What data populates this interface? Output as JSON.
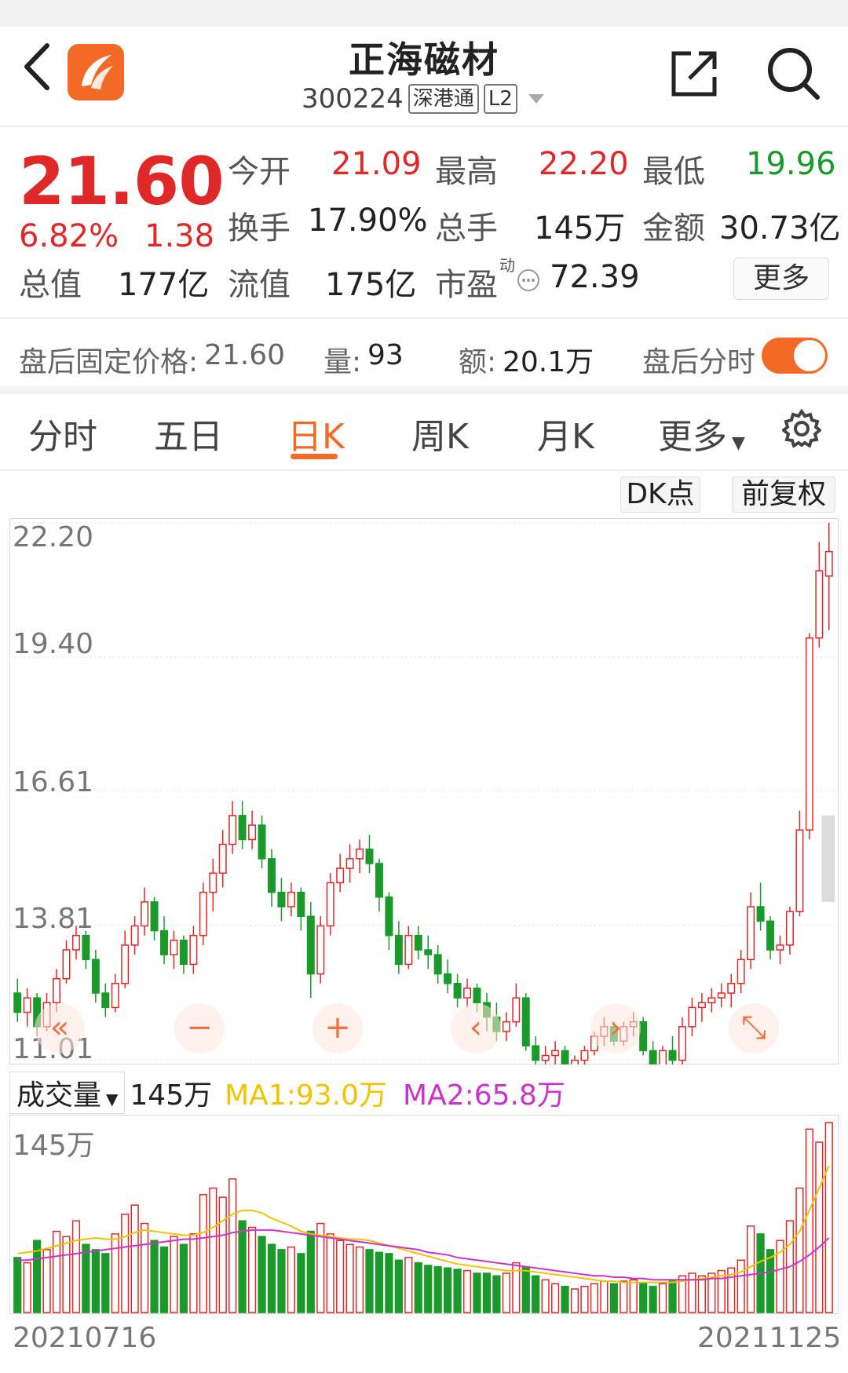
{
  "header": {
    "title": "正海磁材",
    "code": "300224",
    "tag1": "深港通",
    "tag2": "L2"
  },
  "quote": {
    "price": "21.60",
    "change_pct": "6.82%",
    "change": "1.38",
    "open_label": "今开",
    "open": "21.09",
    "high_label": "最高",
    "high": "22.20",
    "low_label": "最低",
    "low": "19.96",
    "turnover_label": "换手",
    "turnover": "17.90%",
    "volume_label": "总手",
    "volume": "145万",
    "amount_label": "金额",
    "amount": "30.73亿",
    "mcap_label": "总值",
    "mcap": "177亿",
    "float_label": "流值",
    "float": "175亿",
    "pe_label": "市盈",
    "pe_sup": "动",
    "pe": "72.39",
    "more": "更多"
  },
  "afterhours": {
    "price_label": "盘后固定价格:",
    "price": "21.60",
    "vol_label": "量:",
    "vol": "93",
    "amt_label": "额:",
    "amt": "20.1万",
    "toggle_label": "盘后分时"
  },
  "tabs": [
    "分时",
    "五日",
    "日K",
    "周K",
    "月K",
    "更多"
  ],
  "chart_buttons": {
    "dk": "DK点",
    "adj": "前复权"
  },
  "volume_header": {
    "label": "成交量",
    "value": "145万",
    "ma1": "MA1:93.0万",
    "ma2": "MA2:65.8万",
    "max": "145万"
  },
  "colors": {
    "up": "#e02828",
    "down": "#1a9a2a",
    "accent": "#f26a26",
    "ma1": "#f3c300",
    "ma2": "#cc33cc"
  },
  "chart_data": {
    "type": "candlestick",
    "y_ticks": [
      "22.20",
      "19.40",
      "16.61",
      "13.81",
      "11.01"
    ],
    "ylim": [
      11.01,
      22.2
    ],
    "x_start": "20210716",
    "x_end": "20211125",
    "candles": [
      [
        12.4,
        12.7,
        11.8,
        12.0
      ],
      [
        12.0,
        12.5,
        11.7,
        12.3
      ],
      [
        12.3,
        12.4,
        11.5,
        11.7
      ],
      [
        11.7,
        12.4,
        11.6,
        12.2
      ],
      [
        12.2,
        12.9,
        12.0,
        12.7
      ],
      [
        12.7,
        13.5,
        12.6,
        13.3
      ],
      [
        13.3,
        13.8,
        13.1,
        13.6
      ],
      [
        13.6,
        13.7,
        12.9,
        13.1
      ],
      [
        13.1,
        13.3,
        12.2,
        12.4
      ],
      [
        12.4,
        12.6,
        11.9,
        12.1
      ],
      [
        12.1,
        12.8,
        12.0,
        12.6
      ],
      [
        12.6,
        13.7,
        12.5,
        13.4
      ],
      [
        13.4,
        14.0,
        13.2,
        13.8
      ],
      [
        13.8,
        14.6,
        13.6,
        14.3
      ],
      [
        14.3,
        14.4,
        13.5,
        13.7
      ],
      [
        13.7,
        14.0,
        13.0,
        13.2
      ],
      [
        13.2,
        13.7,
        12.9,
        13.5
      ],
      [
        13.5,
        13.6,
        12.8,
        13.0
      ],
      [
        13.0,
        13.8,
        12.8,
        13.6
      ],
      [
        13.6,
        14.7,
        13.4,
        14.5
      ],
      [
        14.5,
        15.2,
        14.1,
        14.9
      ],
      [
        14.9,
        15.8,
        14.6,
        15.5
      ],
      [
        15.5,
        16.4,
        15.3,
        16.1
      ],
      [
        16.1,
        16.4,
        15.4,
        15.6
      ],
      [
        15.6,
        16.2,
        15.4,
        15.9
      ],
      [
        15.9,
        16.1,
        15.0,
        15.2
      ],
      [
        15.2,
        15.4,
        14.2,
        14.5
      ],
      [
        14.5,
        14.8,
        13.9,
        14.2
      ],
      [
        14.2,
        14.7,
        14.0,
        14.5
      ],
      [
        14.5,
        14.6,
        13.7,
        14.0
      ],
      [
        14.0,
        14.3,
        12.3,
        12.8
      ],
      [
        12.8,
        14.0,
        12.6,
        13.8
      ],
      [
        13.8,
        14.9,
        13.6,
        14.7
      ],
      [
        14.7,
        15.3,
        14.5,
        15.0
      ],
      [
        15.0,
        15.5,
        14.7,
        15.2
      ],
      [
        15.2,
        15.6,
        14.9,
        15.4
      ],
      [
        15.4,
        15.7,
        14.9,
        15.1
      ],
      [
        15.1,
        15.2,
        14.1,
        14.4
      ],
      [
        14.4,
        14.5,
        13.3,
        13.6
      ],
      [
        13.6,
        13.9,
        12.8,
        13.0
      ],
      [
        13.0,
        13.8,
        12.9,
        13.6
      ],
      [
        13.6,
        13.8,
        13.1,
        13.3
      ],
      [
        13.3,
        13.6,
        12.9,
        13.2
      ],
      [
        13.2,
        13.4,
        12.6,
        12.8
      ],
      [
        12.8,
        13.1,
        12.4,
        12.6
      ],
      [
        12.6,
        12.8,
        12.1,
        12.3
      ],
      [
        12.3,
        12.7,
        12.1,
        12.5
      ],
      [
        12.5,
        12.6,
        12.0,
        12.2
      ],
      [
        12.2,
        12.4,
        11.6,
        11.9
      ],
      [
        11.9,
        12.2,
        11.4,
        11.6
      ],
      [
        11.6,
        12.0,
        11.4,
        11.8
      ],
      [
        11.8,
        12.6,
        11.7,
        12.3
      ],
      [
        12.3,
        12.4,
        11.2,
        11.3
      ],
      [
        11.3,
        11.5,
        10.9,
        11.0
      ],
      [
        11.0,
        11.3,
        10.8,
        11.1
      ],
      [
        11.1,
        11.4,
        10.9,
        11.2
      ],
      [
        11.2,
        11.3,
        10.8,
        10.9
      ],
      [
        10.9,
        11.1,
        10.8,
        11.0
      ],
      [
        11.0,
        11.3,
        10.9,
        11.2
      ],
      [
        11.2,
        11.6,
        11.1,
        11.5
      ],
      [
        11.5,
        11.9,
        11.3,
        11.7
      ],
      [
        11.7,
        11.8,
        11.3,
        11.4
      ],
      [
        11.4,
        11.8,
        11.3,
        11.7
      ],
      [
        11.7,
        12.0,
        11.5,
        11.8
      ],
      [
        11.8,
        11.9,
        11.1,
        11.2
      ],
      [
        11.2,
        11.4,
        10.8,
        10.9
      ],
      [
        10.9,
        11.3,
        10.8,
        11.2
      ],
      [
        11.2,
        11.5,
        10.9,
        11.0
      ],
      [
        11.0,
        11.9,
        10.9,
        11.7
      ],
      [
        11.7,
        12.3,
        11.5,
        12.1
      ],
      [
        12.1,
        12.4,
        11.8,
        12.2
      ],
      [
        12.2,
        12.5,
        12.0,
        12.3
      ],
      [
        12.3,
        12.6,
        12.1,
        12.4
      ],
      [
        12.4,
        12.8,
        12.1,
        12.6
      ],
      [
        12.6,
        13.3,
        12.4,
        13.1
      ],
      [
        13.1,
        14.5,
        12.9,
        14.2
      ],
      [
        14.2,
        14.7,
        13.7,
        13.9
      ],
      [
        13.9,
        14.0,
        13.1,
        13.3
      ],
      [
        13.3,
        13.6,
        13.0,
        13.4
      ],
      [
        13.4,
        14.2,
        13.2,
        14.1
      ],
      [
        14.1,
        16.2,
        14.0,
        15.8
      ],
      [
        15.8,
        19.9,
        15.6,
        19.8
      ],
      [
        19.8,
        21.8,
        19.6,
        21.2
      ],
      [
        21.09,
        22.2,
        19.96,
        21.6
      ]
    ],
    "volume": [
      42,
      38,
      55,
      48,
      62,
      58,
      70,
      52,
      48,
      45,
      60,
      75,
      82,
      68,
      55,
      50,
      58,
      52,
      60,
      90,
      95,
      88,
      102,
      70,
      65,
      58,
      52,
      48,
      50,
      45,
      62,
      68,
      60,
      55,
      52,
      50,
      48,
      46,
      45,
      40,
      42,
      38,
      36,
      35,
      34,
      33,
      32,
      30,
      30,
      28,
      30,
      38,
      35,
      28,
      25,
      22,
      20,
      18,
      20,
      22,
      24,
      22,
      24,
      25,
      22,
      20,
      22,
      24,
      28,
      30,
      28,
      30,
      32,
      34,
      40,
      66,
      60,
      48,
      55,
      70,
      95,
      140,
      130,
      145
    ],
    "ma1": [
      45,
      46,
      47,
      49,
      51,
      53,
      55,
      56,
      57,
      56,
      56,
      58,
      61,
      63,
      62,
      61,
      60,
      59,
      59,
      61,
      65,
      70,
      75,
      78,
      78,
      76,
      72,
      69,
      66,
      62,
      60,
      59,
      58,
      57,
      56,
      56,
      55,
      53,
      51,
      49,
      47,
      45,
      43,
      41,
      39,
      37,
      36,
      35,
      34,
      33,
      32,
      32,
      32,
      31,
      30,
      29,
      28,
      27,
      26,
      25,
      24,
      24,
      23,
      23,
      23,
      23,
      23,
      23,
      24,
      25,
      26,
      27,
      28,
      29,
      31,
      35,
      39,
      42,
      46,
      52,
      62,
      78,
      95,
      112
    ],
    "ma2": [
      40,
      40,
      41,
      42,
      43,
      44,
      45,
      46,
      47,
      48,
      49,
      50,
      51,
      52,
      53,
      54,
      55,
      56,
      56,
      57,
      58,
      59,
      61,
      62,
      63,
      63,
      63,
      62,
      61,
      60,
      59,
      58,
      57,
      56,
      55,
      54,
      53,
      52,
      51,
      50,
      49,
      48,
      46,
      45,
      44,
      42,
      41,
      40,
      39,
      38,
      37,
      36,
      35,
      34,
      33,
      32,
      31,
      30,
      29,
      28,
      28,
      27,
      27,
      26,
      26,
      25,
      25,
      25,
      25,
      25,
      25,
      26,
      26,
      27,
      28,
      29,
      30,
      31,
      33,
      35,
      39,
      44,
      50,
      57
    ],
    "vol_max": 145
  }
}
